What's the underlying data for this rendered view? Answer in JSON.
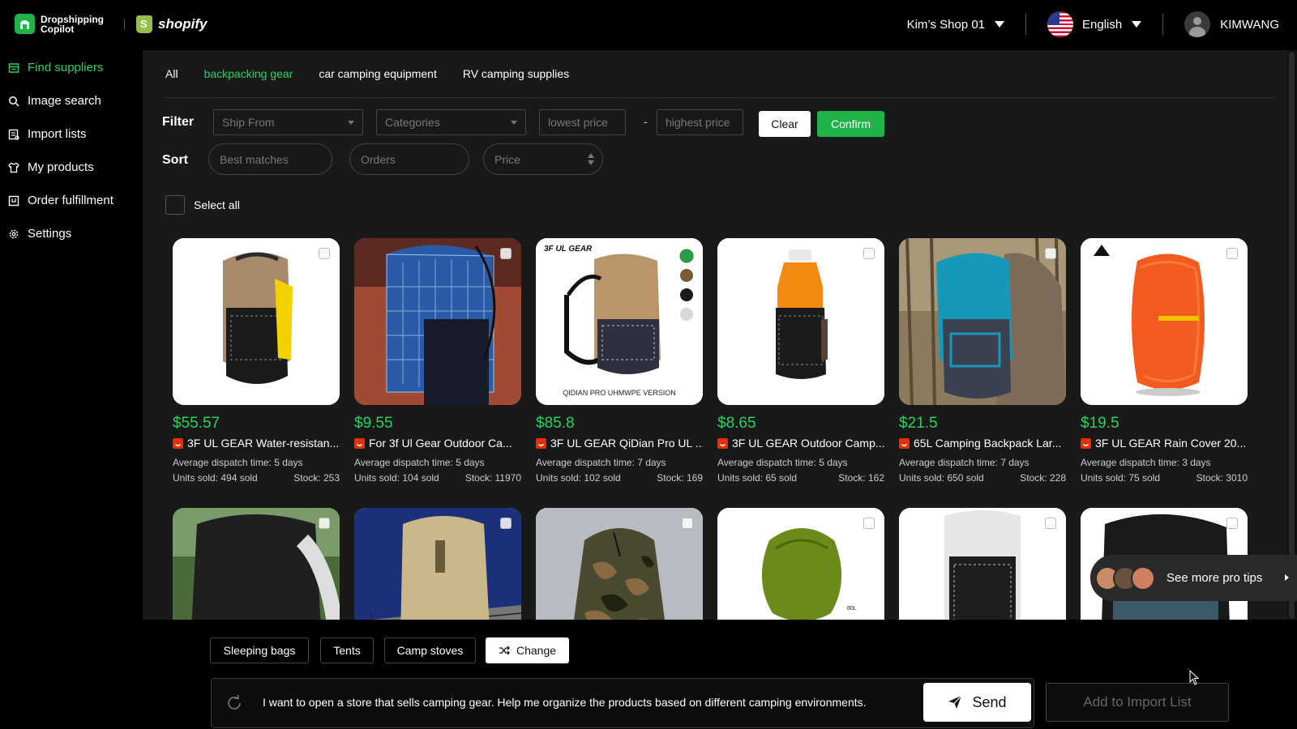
{
  "brand": {
    "name": "Dropshipping Copilot",
    "platform": "shopify"
  },
  "header": {
    "shop": "Kim’s Shop 01",
    "language": "English",
    "user": "KIMWANG"
  },
  "sidebar": {
    "items": [
      {
        "label": "Find suppliers",
        "icon": "store-icon",
        "active": true
      },
      {
        "label": "Image search",
        "icon": "search-icon"
      },
      {
        "label": "Import lists",
        "icon": "list-icon"
      },
      {
        "label": "My products",
        "icon": "shirt-icon"
      },
      {
        "label": "Order fulfillment",
        "icon": "order-icon"
      },
      {
        "label": "Settings",
        "icon": "gear-icon"
      }
    ]
  },
  "tabs": [
    {
      "label": "All"
    },
    {
      "label": "backpacking gear",
      "active": true
    },
    {
      "label": "car camping equipment"
    },
    {
      "label": "RV camping supplies"
    }
  ],
  "filter": {
    "label": "Filter",
    "ship_from": "Ship From",
    "categories": "Categories",
    "lowest_price": "lowest price",
    "dash": "-",
    "highest_price": "highest price",
    "clear": "Clear",
    "confirm": "Confirm"
  },
  "sort": {
    "label": "Sort",
    "best": "Best matches",
    "orders": "Orders",
    "price": "Price"
  },
  "select_all": "Select all",
  "dispatch_prefix": "Average dispatch time: ",
  "products": [
    {
      "price": "$55.57",
      "title": "3F UL GEAR Water-resistan...",
      "dispatch": "5 days",
      "units": "494 sold",
      "stock": "253"
    },
    {
      "price": "$9.55",
      "title": "For 3f Ul Gear Outdoor Ca...",
      "dispatch": "5 days",
      "units": "104 sold",
      "stock": "11970"
    },
    {
      "price": "$85.8",
      "title": "3F UL GEAR QiDian Pro UL ...",
      "dispatch": "7 days",
      "units": "102 sold",
      "stock": "169"
    },
    {
      "price": "$8.65",
      "title": "3F UL GEAR Outdoor Camp...",
      "dispatch": "5 days",
      "units": "65 sold",
      "stock": "162"
    },
    {
      "price": "$21.5",
      "title": "65L Camping Backpack Lar...",
      "dispatch": "7 days",
      "units": "650 sold",
      "stock": "228"
    },
    {
      "price": "$19.5",
      "title": "3F UL GEAR Rain Cover 20...",
      "dispatch": "3 days",
      "units": "75 sold",
      "stock": "3010"
    }
  ],
  "product_labels": {
    "units": "Units sold: ",
    "stock": "Stock: "
  },
  "image_text": {
    "brand_3f": "3F UL GEAR",
    "qidian": "QIDIAN PRO UHMWPE VERSION",
    "cap": "80L"
  },
  "pro_tips": "See more pro tips",
  "suggestions": [
    "Sleeping bags",
    "Tents",
    "Camp stoves"
  ],
  "change": "Change",
  "prompt": "I want to open a store that sells camping gear. Help me organize the products based on different camping environments.",
  "send": "Send",
  "add_to_import": "Add to Import List",
  "colors": {
    "accent": "#2ad15f",
    "brand": "#1fb34a",
    "panel": "#191919"
  }
}
